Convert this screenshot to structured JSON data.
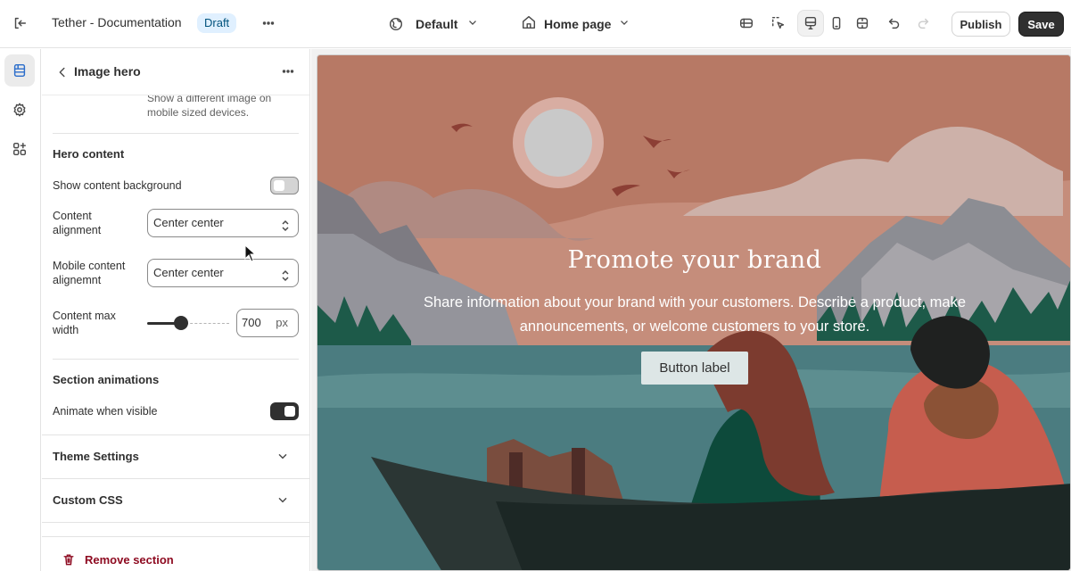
{
  "topbar": {
    "title": "Tether - Documentation",
    "badge": "Draft",
    "theme_dropdown": "Default",
    "page_dropdown": "Home page",
    "publish_label": "Publish",
    "save_label": "Save"
  },
  "panel": {
    "title": "Image hero",
    "mobile_image_help": "Show a different image on mobile sized devices.",
    "hero_content": {
      "title": "Hero content",
      "show_background_label": "Show content background",
      "show_background_on": false,
      "content_alignment_label": "Content alignment",
      "content_alignment_value": "Center center",
      "mobile_alignment_label": "Mobile content alignemnt",
      "mobile_alignment_value": "Center center",
      "max_width_label": "Content max width",
      "max_width_value": "700",
      "max_width_unit": "px"
    },
    "animations": {
      "title": "Section animations",
      "animate_label": "Animate when visible",
      "animate_on": true
    },
    "accordions": [
      "Theme Settings",
      "Custom CSS"
    ],
    "remove_label": "Remove section"
  },
  "hero": {
    "heading": "Promote your brand",
    "text": "Share information about your brand with your customers. Describe a product, make announcements, or welcome customers to your store.",
    "button_label": "Button label"
  },
  "colors": {
    "sky": "#c9907e",
    "water": "#4b7c80",
    "forest": "#1d5a49",
    "boat": "#2b3634",
    "accent_blue": "#2c6ecb",
    "danger": "#8e0b21"
  }
}
